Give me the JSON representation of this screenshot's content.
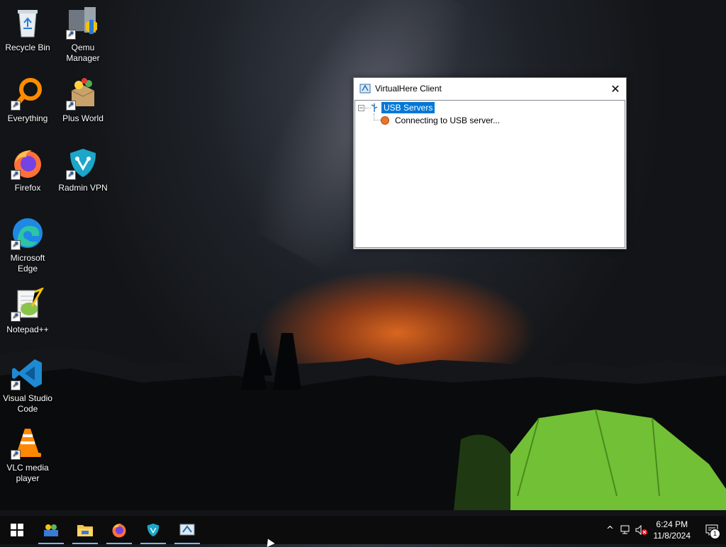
{
  "desktop": {
    "icons": [
      {
        "label": "Recycle Bin",
        "icon": "recycle-bin-icon"
      },
      {
        "label": "Qemu Manager",
        "icon": "qemu-manager-icon"
      },
      {
        "label": "Everything",
        "icon": "everything-search-icon"
      },
      {
        "label": "Plus World",
        "icon": "plus-world-icon"
      },
      {
        "label": "Firefox",
        "icon": "firefox-icon"
      },
      {
        "label": "Radmin VPN",
        "icon": "radmin-vpn-icon"
      },
      {
        "label": "Microsoft Edge",
        "icon": "edge-icon"
      },
      {
        "label": "Notepad++",
        "icon": "notepadpp-icon"
      },
      {
        "label": "Visual Studio Code",
        "icon": "vscode-icon"
      },
      {
        "label": "VLC media player",
        "icon": "vlc-icon"
      }
    ]
  },
  "window": {
    "title": "VirtualHere Client",
    "close_glyph": "✕",
    "tree": {
      "root_label": "USB Servers",
      "root_expander": "−",
      "child_label": "Connecting to USB server..."
    }
  },
  "taskbar": {
    "apps": [
      "start-icon",
      "network-people-icon",
      "file-explorer-icon",
      "firefox-icon",
      "radmin-vpn-icon",
      "virtualhere-icon"
    ],
    "tray": {
      "chevron": "^",
      "time": "6:24 PM",
      "date": "11/8/2024",
      "notification_count": "1"
    }
  },
  "colors": {
    "selection": "#0078d7",
    "taskbar": "#0c0c0c",
    "taskbar_indicator": "#76b9ed"
  }
}
